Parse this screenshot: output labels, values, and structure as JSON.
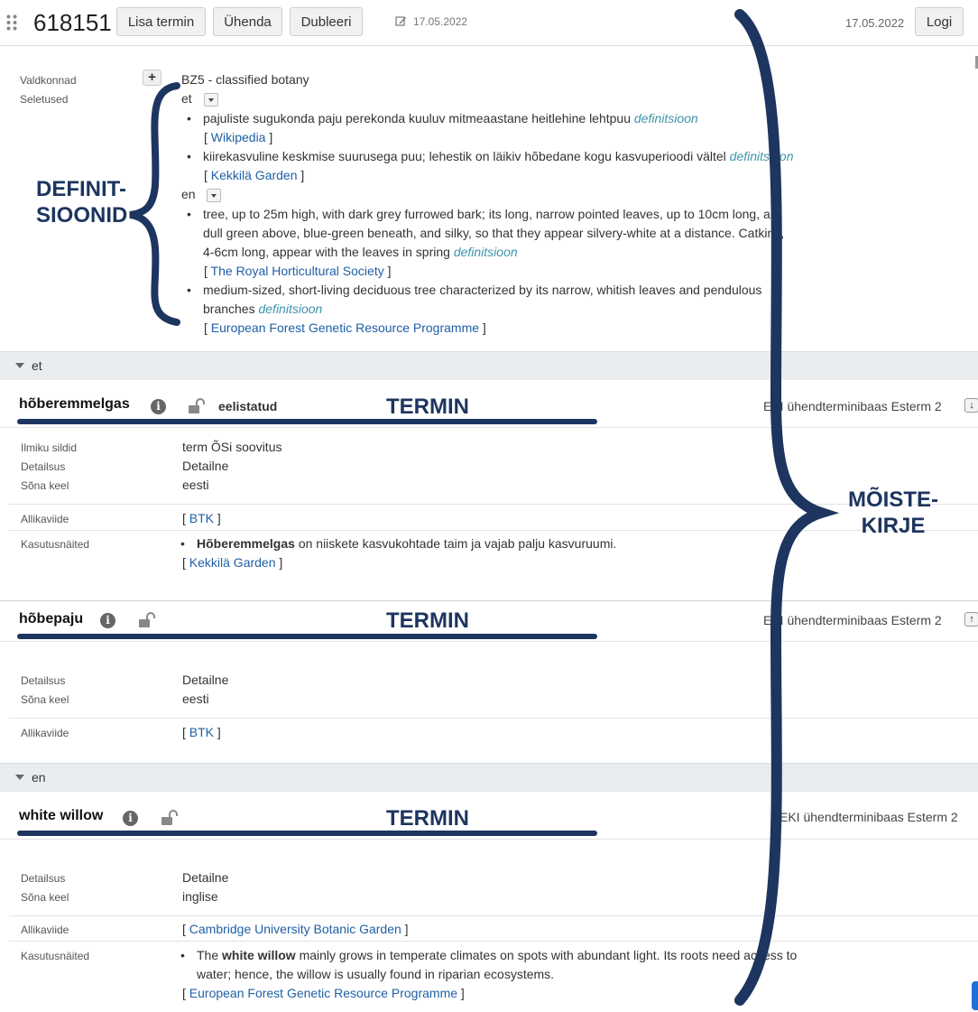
{
  "header": {
    "id": "618151",
    "buttons": [
      "Lisa termin",
      "Ühenda",
      "Dubleeri"
    ],
    "edited_date": "17.05.2022",
    "right_date": "17.05.2022",
    "log_label": "Logi"
  },
  "concept": {
    "domains_label": "Valdkonnad",
    "domains_value": "BZ5 - classified botany",
    "definitions_label": "Seletused",
    "def_groups": [
      {
        "lang": "et",
        "items": [
          {
            "text": "pajuliste sugukonda paju perekonda kuuluv mitmeaastane heitlehine lehtpuu",
            "type": "definitsioon",
            "source": "Wikipedia"
          },
          {
            "text": "kiirekasvuline keskmise suurusega puu; lehestik on läikiv hõbedane kogu kasvuperioodi vältel",
            "type": "definitsioon",
            "source": "Kekkilä Garden"
          }
        ]
      },
      {
        "lang": "en",
        "items": [
          {
            "text_lines": [
              "tree, up to 25m high, with dark grey furrowed bark; its long, narrow pointed leaves, up to 10cm long, are",
              "dull green above, blue-green beneath, and silky, so that they appear silvery-white at a distance. Catkins,",
              "4-6cm long, appear with the leaves in spring"
            ],
            "type": "definitsioon",
            "source": "The Royal Horticultural Society"
          },
          {
            "text_lines": [
              "medium-sized, short-living deciduous tree characterized by its narrow, whitish leaves and pendulous",
              "branches"
            ],
            "type": "definitsioon",
            "source": "European Forest Genetic Resource Programme"
          }
        ]
      }
    ]
  },
  "annotations": {
    "definitions": [
      "DEFINIT-",
      "SIOONID"
    ],
    "term": "TERMIN",
    "concept_entry": [
      "MÕISTE-",
      "KIRJE"
    ]
  },
  "lang_sections": [
    {
      "lang": "et",
      "terms": [
        {
          "name": "hõberemmelgas",
          "status": "eelistatud",
          "db": "EKI ühendterminibaas Esterm 2",
          "arrow": "↓",
          "fields": [
            {
              "label": "Ilmiku sildid",
              "value": "term ÕSi soovitus"
            },
            {
              "label": "Detailsus",
              "value": "Detailne"
            },
            {
              "label": "Sõna keel",
              "value": "eesti"
            }
          ],
          "source_label": "Allikaviide",
          "source": "BTK",
          "example_label": "Kasutusnäited",
          "example_bold": "Hõberemmelgas",
          "example_rest": " on niiskete kasvukohtade taim ja vajab palju kasvuruumi.",
          "example_source": "Kekkilä Garden"
        },
        {
          "name": "hõbepaju",
          "db": "EKI ühendterminibaas Esterm 2",
          "arrow": "↑",
          "fields": [
            {
              "label": "Detailsus",
              "value": "Detailne"
            },
            {
              "label": "Sõna keel",
              "value": "eesti"
            }
          ],
          "source_label": "Allikaviide",
          "source": "BTK"
        }
      ]
    },
    {
      "lang": "en",
      "terms": [
        {
          "name": "white willow",
          "db": "EKI ühendterminibaas Esterm 2",
          "fields": [
            {
              "label": "Detailsus",
              "value": "Detailne"
            },
            {
              "label": "Sõna keel",
              "value": "inglise"
            }
          ],
          "source_label": "Allikaviide",
          "source": "Cambridge University Botanic Garden",
          "example_label": "Kasutusnäited",
          "example_pre": "The ",
          "example_bold": "white willow",
          "example_rest_1": " mainly grows in temperate climates on spots with abundant light. Its roots need access to",
          "example_rest_2": "water; hence, the willow is usually found in riparian ecosystems.",
          "example_source": "European Forest Genetic Resource Programme"
        }
      ]
    }
  ],
  "colors": {
    "annotation": "#1d355f",
    "link": "#1f5fa6",
    "definition_tag": "#3d94a8"
  }
}
